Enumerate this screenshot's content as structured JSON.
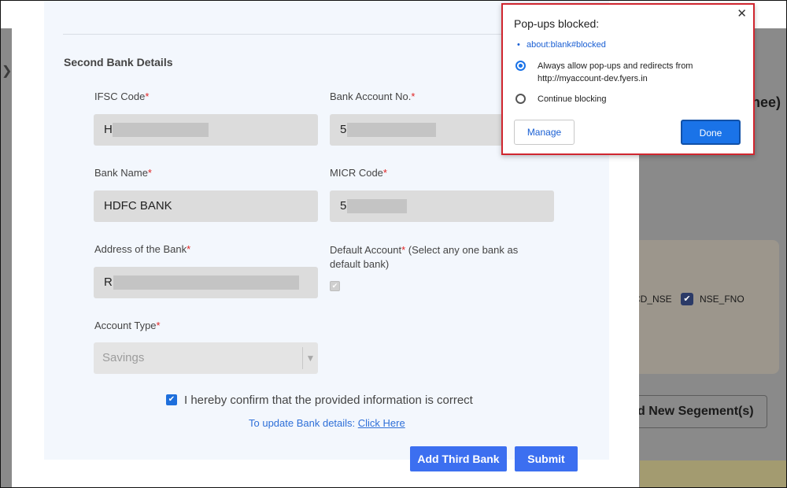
{
  "background": {
    "right_heading_fragment": "nee)",
    "segment_label_1": "CD_NSE",
    "segment_label_2": "NSE_FNO",
    "add_segment_button": "d New Segement(s)"
  },
  "form": {
    "section_title": "Second Bank Details",
    "required_mark": "*",
    "ifsc": {
      "label": "IFSC Code",
      "value": "H"
    },
    "account_no": {
      "label": "Bank Account No.",
      "value": "5"
    },
    "bank_name": {
      "label": "Bank Name",
      "value": "HDFC BANK"
    },
    "micr": {
      "label": "MICR Code",
      "value": "5"
    },
    "address": {
      "label": "Address of the Bank",
      "value": "R"
    },
    "default_account": {
      "label": "Default Account",
      "note": " (Select any one bank as default bank)"
    },
    "account_type": {
      "label": "Account Type",
      "value": "Savings"
    },
    "confirm_text": "I hereby confirm that the provided information is correct",
    "update_prefix": "To update Bank details: ",
    "update_link": "Click Here",
    "add_third_bank": "Add Third Bank",
    "submit": "Submit"
  },
  "popup": {
    "title": "Pop-ups blocked:",
    "close_glyph": "✕",
    "blocked_link": "about:blank#blocked",
    "option_allow": "Always allow pop-ups and redirects from http://myaccount-dev.fyers.in",
    "option_block": "Continue blocking",
    "selected_option": "allow",
    "manage": "Manage",
    "done": "Done"
  },
  "colors": {
    "accent": "#3c6ff0",
    "popup_border": "#d0262f",
    "required": "#e02424"
  }
}
